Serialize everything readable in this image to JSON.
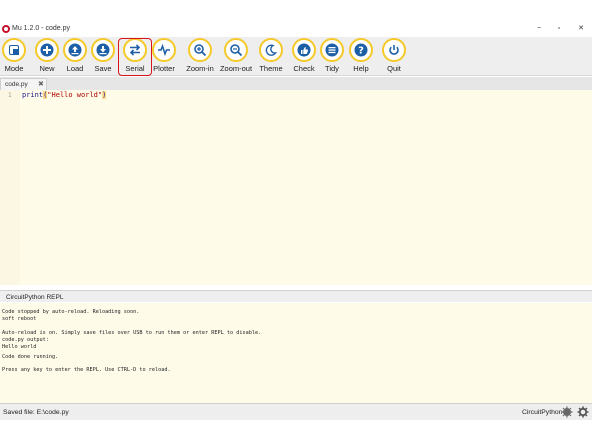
{
  "window": {
    "title": "Mu 1.2.0 - code.py",
    "minimize_glyph": "−",
    "maximize_glyph": "▫",
    "close_glyph": "✕"
  },
  "toolbar": {
    "buttons": [
      {
        "label": "Mode",
        "icon": "mode-icon"
      },
      {
        "label": "New",
        "icon": "plus-icon"
      },
      {
        "label": "Load",
        "icon": "upload-icon"
      },
      {
        "label": "Save",
        "icon": "download-icon"
      },
      {
        "label": "Serial",
        "icon": "swap-arrows-icon"
      },
      {
        "label": "Plotter",
        "icon": "pulse-icon"
      },
      {
        "label": "Zoom-in",
        "icon": "zoom-in-icon"
      },
      {
        "label": "Zoom-out",
        "icon": "zoom-out-icon"
      },
      {
        "label": "Theme",
        "icon": "moon-icon"
      },
      {
        "label": "Check",
        "icon": "thumbs-up-icon"
      },
      {
        "label": "Tidy",
        "icon": "lines-icon"
      },
      {
        "label": "Help",
        "icon": "question-icon"
      },
      {
        "label": "Quit",
        "icon": "power-icon"
      }
    ],
    "accent_color": "#f4c928",
    "highlight_color": "#d8151c"
  },
  "tabs": [
    {
      "label": "code.py",
      "close_glyph": "✖"
    }
  ],
  "editor": {
    "line_number": "1",
    "code": {
      "func": "print",
      "open_paren": "(",
      "string": "\"Hello world\"",
      "close_paren": ")"
    }
  },
  "repl": {
    "title": "CircuitPython REPL",
    "lines": [
      "Code stopped by auto-reload. Reloading soon.",
      "soft reboot",
      "",
      "Auto-reload is on. Simply save files over USB to run them or enter REPL to disable.",
      "code.py output:",
      "Hello world",
      "",
      "Code done running.",
      "",
      "Press any key to enter the REPL. Use CTRL-D to reload."
    ]
  },
  "status": {
    "message": "Saved file: E:\\code.py",
    "mode": "CircuitPython"
  }
}
